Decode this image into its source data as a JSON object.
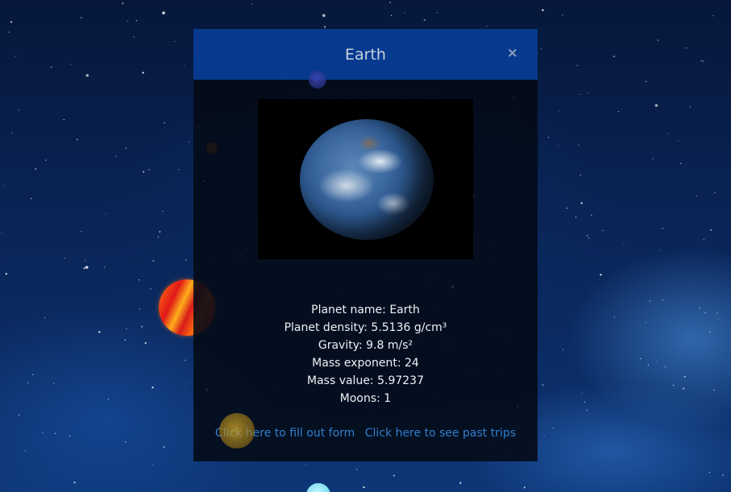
{
  "modal": {
    "title": "Earth",
    "close_label": "×",
    "info": {
      "name": "Planet name: Earth",
      "density": "Planet density: 5.5136 g/cm³",
      "gravity": "Gravity: 9.8 m/s²",
      "mass_exponent": "Mass exponent: 24",
      "mass_value": "Mass value: 5.97237",
      "moons": "Moons: 1"
    },
    "links": {
      "fill_form": "Click here to fill out form",
      "past_trips": "Click here to see past trips"
    }
  },
  "colors": {
    "header_bg": "#073a8f",
    "link": "#2f7fcf",
    "background": "#0a2456"
  }
}
